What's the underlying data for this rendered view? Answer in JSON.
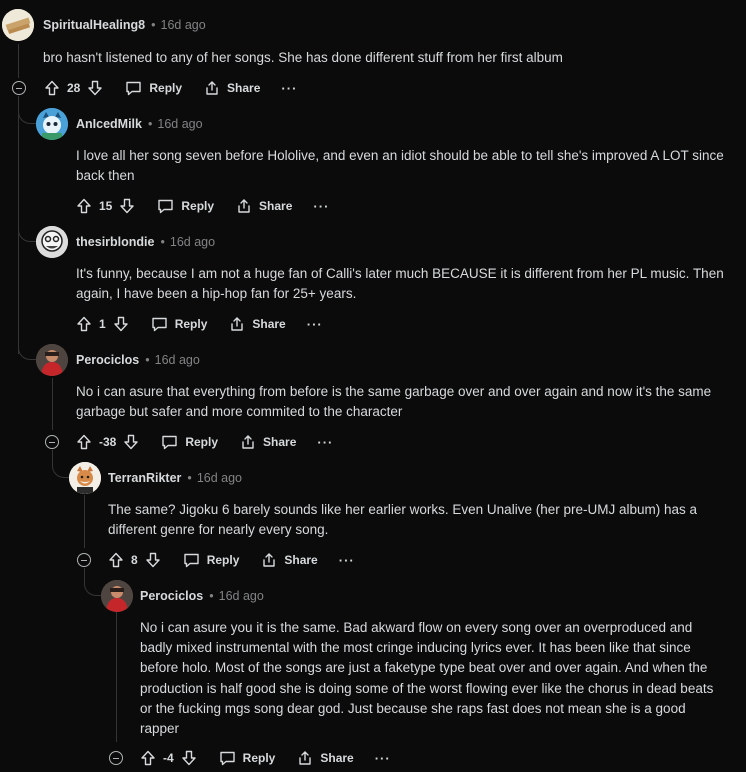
{
  "comments": [
    {
      "author": "SpiritualHealing8",
      "time": "16d ago",
      "body": "bro hasn't listened to any of her songs. She has done different stuff from her first album",
      "score": "28",
      "reply": "Reply",
      "share": "Share",
      "more": "···",
      "avatar": "avatar-beige"
    },
    {
      "author": "AnIcedMilk",
      "time": "16d ago",
      "body": "I love all her song seven before Hololive, and even an idiot should be able to tell she's improved A LOT since back then",
      "score": "15",
      "reply": "Reply",
      "share": "Share",
      "more": "···",
      "avatar": "avatar-blue-cat"
    },
    {
      "author": "thesirblondie",
      "time": "16d ago",
      "body": "It's funny, because I am not a huge fan of Calli's later much BECAUSE it is different from her PL music. Then again, I have been a hip-hop fan for 25+ years.",
      "score": "1",
      "reply": "Reply",
      "share": "Share",
      "more": "···",
      "avatar": "avatar-bw-face"
    },
    {
      "author": "Perociclos",
      "time": "16d ago",
      "body": "No i can asure that everything from before is the same garbage over and over again and now it's the same garbage but safer and more commited to the character",
      "score": "-38",
      "reply": "Reply",
      "share": "Share",
      "more": "···",
      "avatar": "avatar-red"
    },
    {
      "author": "TerranRikter",
      "time": "16d ago",
      "body": "The same? Jigoku 6 barely sounds like her earlier works. Even Unalive (her pre-UMJ album) has a different genre for nearly every song.",
      "score": "8",
      "reply": "Reply",
      "share": "Share",
      "more": "···",
      "avatar": "avatar-fox"
    },
    {
      "author": "Perociclos",
      "time": "16d ago",
      "body": "No i can asure you it is the same. Bad akward flow on every song over an overproduced and badly mixed instrumental with the most cringe inducing lyrics ever. It has been like that since before holo. Most of the songs are just a faketype type beat over and over again. And when the production is half good she is doing some of the worst flowing ever like the chorus in dead beats or the fucking mgs song dear god. Just because she raps fast does not mean she is a good rapper",
      "score": "-4",
      "reply": "Reply",
      "share": "Share",
      "more": "···",
      "avatar": "avatar-red"
    }
  ],
  "colors": {
    "background": "#0b0b0b",
    "text": "#d7dadc",
    "muted": "#818384",
    "thread_line": "#343536"
  }
}
